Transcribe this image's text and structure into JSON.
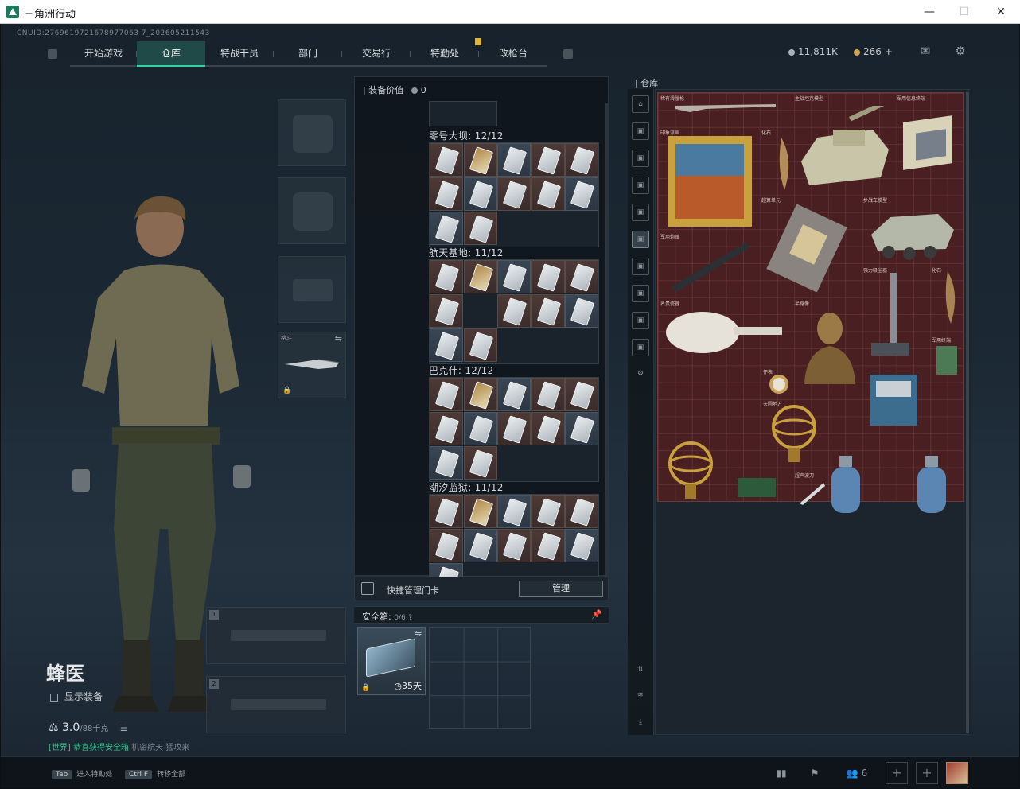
{
  "window": {
    "title": "三角洲行动",
    "min": "—",
    "max": "☐",
    "close": "✕"
  },
  "header": {
    "uid": "CNUID:2769619721678977063 7_202605211543",
    "tabs": [
      {
        "label": "开始游戏",
        "active": false
      },
      {
        "label": "仓库",
        "active": true
      },
      {
        "label": "特战干员",
        "active": false
      },
      {
        "label": "部门",
        "active": false
      },
      {
        "label": "交易行",
        "active": false
      },
      {
        "label": "特勤处",
        "active": false
      },
      {
        "label": "改枪台",
        "active": false
      }
    ],
    "currency_a": "11,811K",
    "currency_b": "266 +",
    "mail_icon": "mail-icon",
    "settings_icon": "gear-icon"
  },
  "operator": {
    "name": "蜂医",
    "show_equipment": "显示装备",
    "weight": "3.0",
    "weight_max": "/88千克",
    "ticker": {
      "prefix": "[世界]",
      "highlight": "恭喜获得安全箱",
      "text": "机密航天 猛攻来"
    }
  },
  "gear_slots": {
    "melee_label": "格斗",
    "weapon1": "1",
    "weapon2": "2"
  },
  "cards_panel": {
    "equip_value_label": "装备价值",
    "equip_value": "0",
    "locations": [
      {
        "name": "零号大坝: 12/12"
      },
      {
        "name": "航天基地: 11/12"
      },
      {
        "name": "巴克什: 12/12"
      },
      {
        "name": "潮汐监狱: 11/12"
      }
    ]
  },
  "quick_manage": {
    "label": "快捷管理门卡",
    "button": "管理"
  },
  "safe_box": {
    "label": "安全箱:",
    "capacity": "0/6",
    "help": "?",
    "days": "35天"
  },
  "stash": {
    "title": "仓库",
    "item_labels": [
      "稀有滑膛枪",
      "主战坦克模型",
      "军用信息终端",
      "印象派画",
      "化石",
      "超算单元",
      "步战车模型",
      "军用炮弹",
      "名贵瓷器",
      "半身像",
      "强力吸尘器",
      "怀表",
      "天圆地方",
      "超声波刀",
      "军用终端"
    ]
  },
  "bottom": {
    "hint1_key": "Tab",
    "hint1": "进入特勤处",
    "hint2_key": "Ctrl F",
    "hint2": "转移全部",
    "friends_count": "6"
  }
}
